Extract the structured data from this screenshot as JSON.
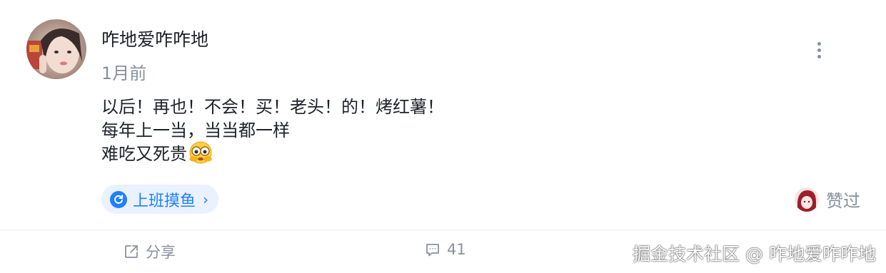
{
  "post": {
    "author": "咋地爱咋咋地",
    "time": "1月前",
    "lines": [
      "以后！再也！不会！买！老头！的！烤红薯！",
      "每年上一当，当当都一样",
      "难吃又死贵"
    ],
    "emoji": "glasses-face-emoji",
    "topic": {
      "label": "上班摸鱼",
      "icon": "refresh-circle-icon"
    },
    "liked_text": "赞过"
  },
  "actions": {
    "share_label": "分享",
    "comment_count": "41"
  },
  "watermark": "掘金技术社区 @ 咋地爱咋咋地",
  "colors": {
    "accent": "#1e80ff",
    "tag_bg": "#eaf2ff",
    "text": "#1d2129",
    "muted": "#86909c",
    "divider": "#ebedf0"
  }
}
